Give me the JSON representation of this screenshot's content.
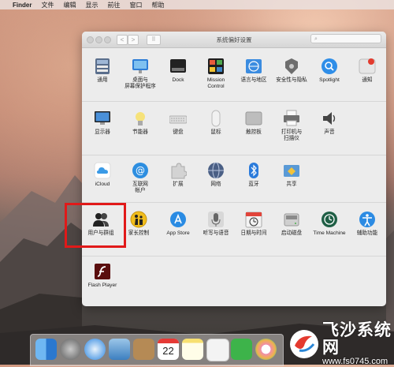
{
  "menubar": {
    "apple": "",
    "items": [
      "Finder",
      "文件",
      "编辑",
      "显示",
      "前往",
      "窗口",
      "帮助"
    ]
  },
  "window": {
    "title": "系统偏好设置",
    "search_placeholder": "",
    "nav_back": "<",
    "nav_forward": ">",
    "grid_glyph": "⠿"
  },
  "sections": [
    [
      {
        "label": "通用",
        "icon": "general-icon"
      },
      {
        "label": "桌面与\n屏幕保护程序",
        "icon": "desktop-icon"
      },
      {
        "label": "Dock",
        "icon": "dock-icon"
      },
      {
        "label": "Mission\nControl",
        "icon": "mission-control-icon"
      },
      {
        "label": "语言与地区",
        "icon": "language-icon"
      },
      {
        "label": "安全性与隐私",
        "icon": "security-icon"
      },
      {
        "label": "Spotlight",
        "icon": "spotlight-icon"
      },
      {
        "label": "通知",
        "icon": "notifications-icon"
      }
    ],
    [
      {
        "label": "显示器",
        "icon": "displays-icon"
      },
      {
        "label": "节能器",
        "icon": "energy-icon"
      },
      {
        "label": "键盘",
        "icon": "keyboard-icon"
      },
      {
        "label": "鼠标",
        "icon": "mouse-icon"
      },
      {
        "label": "触控板",
        "icon": "trackpad-icon"
      },
      {
        "label": "打印机与\n扫描仪",
        "icon": "printer-icon"
      },
      {
        "label": "声音",
        "icon": "sound-icon"
      }
    ],
    [
      {
        "label": "iCloud",
        "icon": "icloud-icon"
      },
      {
        "label": "互联网\n帐户",
        "icon": "internet-accounts-icon"
      },
      {
        "label": "扩展",
        "icon": "extensions-icon"
      },
      {
        "label": "网络",
        "icon": "network-icon"
      },
      {
        "label": "蓝牙",
        "icon": "bluetooth-icon"
      },
      {
        "label": "共享",
        "icon": "sharing-icon"
      }
    ],
    [
      {
        "label": "用户与群组",
        "icon": "users-groups-icon"
      },
      {
        "label": "家长控制",
        "icon": "parental-controls-icon"
      },
      {
        "label": "App Store",
        "icon": "app-store-icon"
      },
      {
        "label": "听写与语音",
        "icon": "dictation-icon"
      },
      {
        "label": "日期与时间",
        "icon": "date-time-icon"
      },
      {
        "label": "启动磁盘",
        "icon": "startup-disk-icon"
      },
      {
        "label": "Time Machine",
        "icon": "time-machine-icon"
      },
      {
        "label": "辅助功能",
        "icon": "accessibility-icon"
      }
    ],
    [
      {
        "label": "Flash Player",
        "icon": "flash-player-icon"
      }
    ]
  ],
  "dock": {
    "calendar_day": "22",
    "items": [
      "finder-icon",
      "launchpad-icon",
      "safari-icon",
      "mail-icon",
      "contacts-icon",
      "calendar-icon",
      "notes-icon",
      "reminders-icon",
      "facetime-icon",
      "photos-icon"
    ]
  },
  "watermark": {
    "title": "飞沙系统网",
    "url": "www.fs0745.com"
  },
  "colors": {
    "highlight": "#e11919"
  }
}
